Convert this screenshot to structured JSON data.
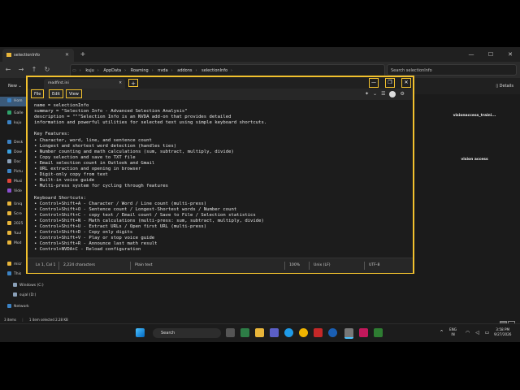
{
  "explorer": {
    "tab_title": "selectionInfo",
    "breadcrumb": [
      "kuju",
      "AppData",
      "Roaming",
      "nvda",
      "addons",
      "selectionInfo"
    ],
    "search_placeholder": "Search selectionInfo",
    "new_label": "New",
    "details_label": "Details",
    "sidebar_items": [
      {
        "label": "Hom",
        "color": "#3b82c4"
      },
      {
        "label": "Galle",
        "color": "#2fa36b"
      },
      {
        "label": "kuju",
        "color": "#3b82c4"
      },
      {
        "label": "Desk",
        "color": "#3b82c4"
      },
      {
        "label": "Dow",
        "color": "#3aa0e0"
      },
      {
        "label": "Doc",
        "color": "#8aa0b8"
      },
      {
        "label": "Pictu",
        "color": "#3b82c4"
      },
      {
        "label": "Musi",
        "color": "#e0453a"
      },
      {
        "label": "Vide",
        "color": "#8a4fd0"
      },
      {
        "label": "Uniq",
        "color": "#e8b53a"
      },
      {
        "label": "Scre",
        "color": "#e8b53a"
      },
      {
        "label": "2025",
        "color": "#e8b53a"
      },
      {
        "label": "Yuul",
        "color": "#e8b53a"
      },
      {
        "label": "Mod",
        "color": "#e8b53a"
      }
    ],
    "sidebar_lower": [
      {
        "label": "micr",
        "color": "#e8b53a"
      },
      {
        "label": "This",
        "color": "#3b82c4"
      },
      {
        "label": "Windows (C:)",
        "color": "#8aa0b8"
      },
      {
        "label": "sujal (D:)",
        "color": "#8aa0b8"
      },
      {
        "label": "Network",
        "color": "#3b82c4"
      }
    ],
    "tiles": [
      "visionaccess_traini...",
      "vision access"
    ],
    "status": [
      "3 items",
      "1 item selected 2.28 KB"
    ]
  },
  "notepad": {
    "tab_title": "readfirst.ini",
    "menu": [
      "File",
      "Edit",
      "View"
    ],
    "lines": [
      "name = selectionInfo",
      "summary = \"Selection Info - Advanced Selection Analysis\"",
      "description = \"\"\"Selection Info is an NVDA add-on that provides detailed",
      "information and powerful utilities for selected text using simple keyboard shortcuts.",
      "",
      "Key Features:",
      "• Character, word, line, and sentence count",
      "• Longest and shortest word detection (handles ties)",
      "• Number counting and math calculations (sum, subtract, multiply, divide)",
      "• Copy selection and save to TXT file",
      "• Email selection count in Outlook and Gmail",
      "• URL extraction and opening in browser",
      "• Digit-only copy from text",
      "• Built-in voice guide",
      "• Multi-press system for cycling through features",
      "",
      "Keyboard Shortcuts:",
      "• Control+Shift+A - Character / Word / Line count (multi-press)",
      "• Control+Shift+O - Sentence count / Longest-Shortest words / Number count",
      "• Control+Shift+C - copy text / Email count / Save to File / Selection statistics",
      "• Control+Shift+N - Math calculations (multi-press: sum, subtract, multiply, divide)",
      "• Control+Shift+U - Extract URLs / Open first URL (multi-press)",
      "• Control+Shift+D - Copy only digits",
      "• Control+Shift+V - Play or stop voice guide",
      "• Control+Shift+R - Announce last math result",
      "• Control+NVDA+C - Reload configuration"
    ],
    "status": {
      "position": "Ln 1, Col 1",
      "chars": "2,224 characters",
      "format": "Plain text",
      "zoom": "100%",
      "eol": "Unix (LF)",
      "encoding": "UTF-8"
    }
  },
  "taskbar": {
    "search_label": "Search",
    "lang_top": "ENG",
    "lang_bottom": "IN",
    "time": "3:58 PM",
    "date": "9/27/2026"
  }
}
